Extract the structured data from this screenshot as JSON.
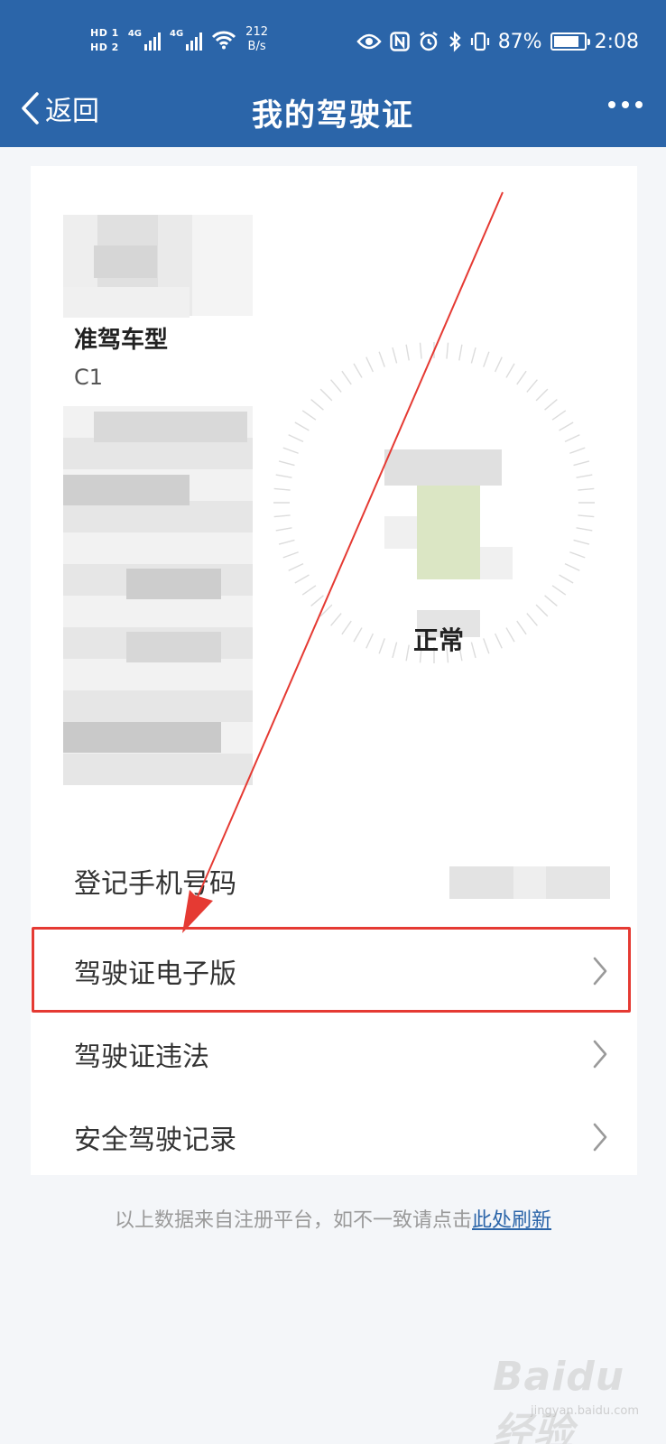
{
  "status_bar": {
    "hd1": "HD 1",
    "hd2": "HD 2",
    "net1": "4G",
    "net2": "4G",
    "speed_value": "212",
    "speed_unit": "B/s",
    "battery": "87%",
    "battery_level": 0.87,
    "time": "2:08"
  },
  "nav": {
    "back_label": "返回",
    "title": "我的驾驶证",
    "more_icon": "more-dots-icon"
  },
  "license": {
    "type_label": "准驾车型",
    "type_value": "C1",
    "status": "正常"
  },
  "menu": {
    "phone_label": "登记手机号码",
    "ecard_label": "驾驶证电子版",
    "violation_label": "驾驶证违法",
    "safe_label": "安全驾驶记录"
  },
  "footer": {
    "text": "以上数据来自注册平台，如不一致请点击",
    "link": "此处刷新"
  },
  "watermark": {
    "text": "Baidu经验",
    "sub": "jingyan.baidu.com"
  },
  "colors": {
    "header": "#2b65a9",
    "highlight": "#e53a33"
  }
}
